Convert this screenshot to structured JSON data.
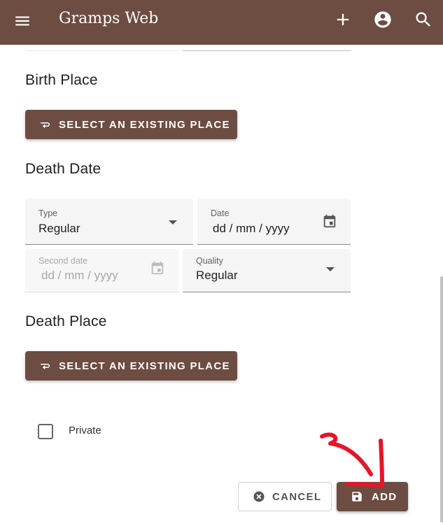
{
  "app": {
    "title": "Gramps Web"
  },
  "icons": {
    "menu": "menu-icon",
    "add": "add-icon",
    "account": "account-circle-icon",
    "search": "search-icon",
    "place": "place-link-icon",
    "calendar": "calendar-icon",
    "dropdown": "arrow-drop-down-icon",
    "cancel": "cancel-icon",
    "save": "save-icon"
  },
  "birth_place": {
    "heading": "Birth Place",
    "button": "SELECT AN EXISTING PLACE"
  },
  "death_date": {
    "heading": "Death Date",
    "type": {
      "label": "Type",
      "value": "Regular"
    },
    "date": {
      "label": "Date",
      "placeholder": "dd / mm / yyyy"
    },
    "second_date": {
      "label": "Second date",
      "placeholder": "dd / mm / yyyy"
    },
    "quality": {
      "label": "Quality",
      "value": "Regular"
    }
  },
  "death_place": {
    "heading": "Death Place",
    "button": "SELECT AN EXISTING PLACE"
  },
  "private": {
    "label": "Private",
    "checked": false
  },
  "actions": {
    "cancel": "CANCEL",
    "add": "ADD"
  },
  "colors": {
    "primary": "#6d4c41",
    "annotation": "#e3162a"
  }
}
